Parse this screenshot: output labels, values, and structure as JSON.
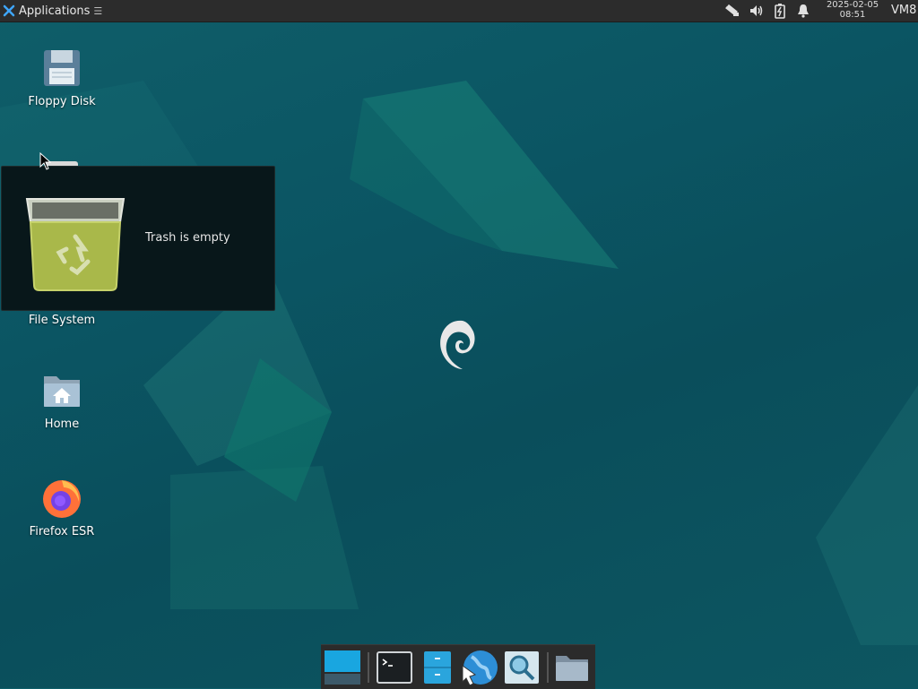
{
  "panel": {
    "applications_label": "Applications",
    "applications_grip": "☰",
    "clock_date": "2025-02-05",
    "clock_time": "08:51",
    "user": "VM8"
  },
  "desktop": {
    "icons": [
      {
        "label": "Floppy Disk",
        "icon": "floppy-disk-icon"
      },
      {
        "label": "File System",
        "icon": "hard-drive-icon"
      },
      {
        "label": "Home",
        "icon": "home-folder-icon"
      },
      {
        "label": "Firefox ESR",
        "icon": "firefox-icon"
      }
    ]
  },
  "tooltip": {
    "message": "Trash is empty",
    "icon": "trash-icon"
  },
  "dock": {
    "items": [
      {
        "icon": "show-desktop-icon"
      },
      {
        "icon": "terminal-icon"
      },
      {
        "icon": "file-manager-icon"
      },
      {
        "icon": "web-browser-icon"
      },
      {
        "icon": "app-finder-icon"
      },
      {
        "icon": "folder-icon"
      }
    ]
  },
  "colors": {
    "desktop_bg": "#0b5563",
    "panel_bg": "#2c2c2c",
    "tooltip_bg": "#08171a"
  }
}
